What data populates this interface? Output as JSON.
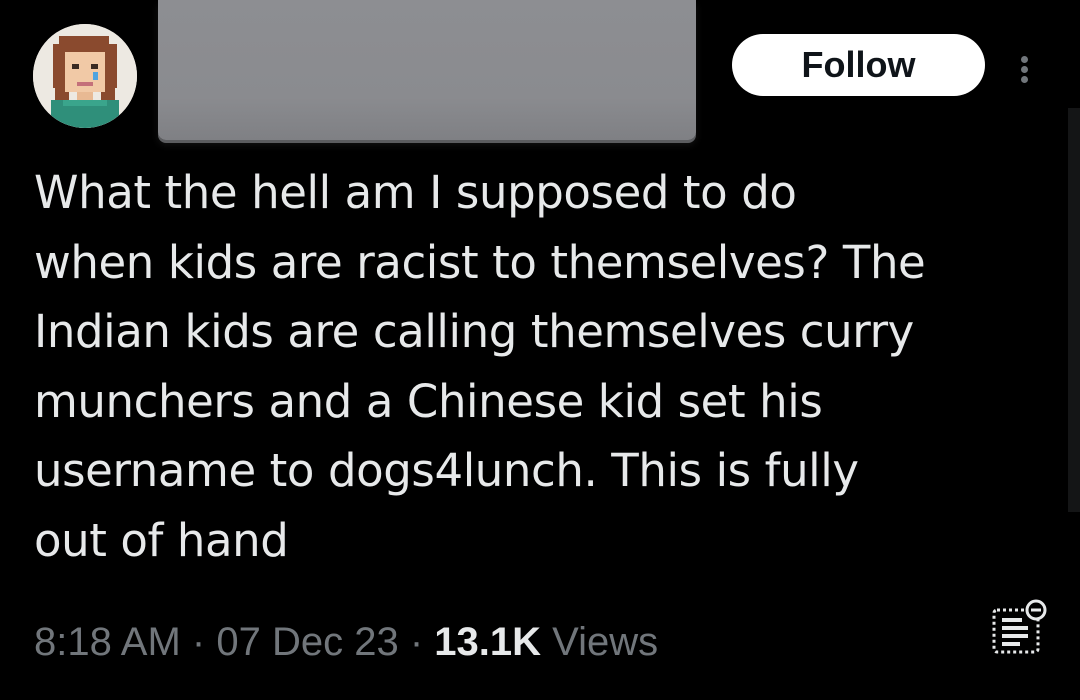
{
  "tweet": {
    "avatar_icon": "pixel-art-avatar",
    "follow_label": "Follow",
    "more_icon": "more-vertical-icon",
    "text": "What the hell am I supposed to do\nwhen kids are racist to themselves? The\nIndian kids are calling themselves curry\nmunchers and a Chinese kid set his\nusername to dogs4lunch. This is fully\nout of hand",
    "time": "8:18 AM",
    "separator": "·",
    "date": "07 Dec 23",
    "views_count": "13.1K",
    "views_label": "Views",
    "analytics_icon": "post-analytics-icon"
  },
  "colors": {
    "background": "#000000",
    "text_primary": "#e7e9ea",
    "text_secondary": "#71767b",
    "follow_bg": "#ffffff",
    "follow_text": "#0f1419",
    "redaction": "#8a8b8f"
  }
}
